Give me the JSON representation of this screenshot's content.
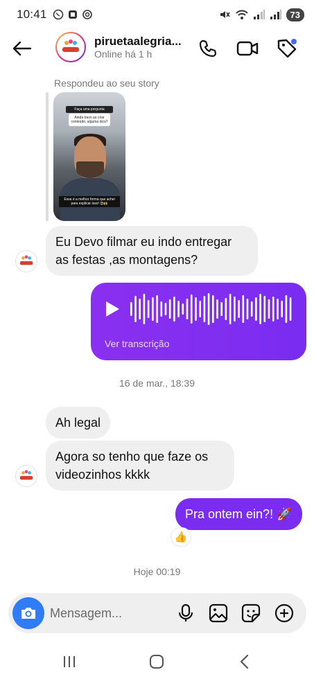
{
  "status_bar": {
    "time": "10:41",
    "battery": "73",
    "left_icons": [
      "whatsapp-icon",
      "office-icon",
      "sync-icon"
    ],
    "right_icons": [
      "mute-icon",
      "wifi-icon",
      "signal-icon",
      "signal-icon"
    ]
  },
  "header": {
    "contact_name": "piruetaalegria...",
    "contact_status": "Online há 1 h",
    "icons": [
      "back-arrow-icon",
      "phone-icon",
      "video-camera-icon",
      "tag-icon"
    ]
  },
  "chat": {
    "story_reply_label": "Respondeu ao seu story",
    "story_question_header": "Faça uma pergunta",
    "story_question": "Ainda travo ao criar conteúdo, alguma dica?",
    "story_caption": "Essa é a melhor forma que achei para explicar isso! 😍🙌",
    "messages_in_1": "Eu Devo filmar eu indo entregar as festas ,as montagens?",
    "voice_transcript_link": "Ver transcrição",
    "timestamp_1": "16 de mar., 18:39",
    "messages_in_2": "Ah legal",
    "messages_in_3": "Agora so tenho que faze os videozinhos kkkk",
    "message_out_1": "Pra ontem ein?! 🚀",
    "reaction": "👍",
    "timestamp_2": "Hoje 00:19",
    "avatar_logo_text": "Pirueta"
  },
  "composer": {
    "placeholder": "Mensagem...",
    "icons": [
      "camera-icon",
      "microphone-icon",
      "gallery-icon",
      "sticker-icon",
      "plus-icon"
    ],
    "accent": "#2f7cf6"
  },
  "navbar": {
    "buttons": [
      "recent-apps-icon",
      "home-icon",
      "back-icon"
    ]
  },
  "colors": {
    "outgoing_bubble": "#7a2cf1",
    "incoming_bubble": "#efefef",
    "story_ring_gradient": [
      "#f9ce34",
      "#ee2a7b",
      "#6228d7"
    ]
  }
}
